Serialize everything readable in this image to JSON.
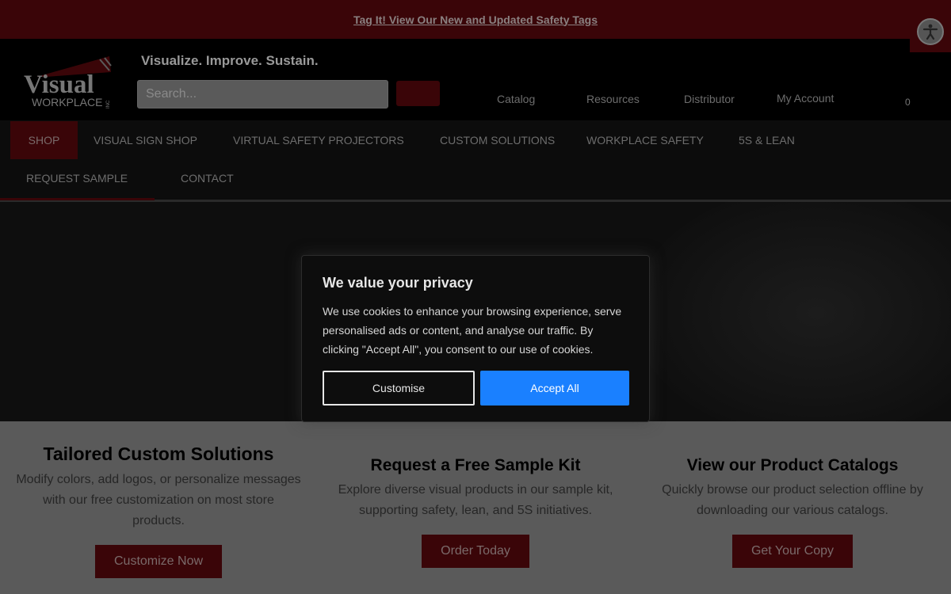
{
  "promo": {
    "link": "Tag It! View Our New and Updated Safety Tags"
  },
  "header": {
    "logo_text": "Visual",
    "logo_sub": "WORKPLACE",
    "logo_inc": "INC",
    "tagline": "Visualize. Improve. Sustain.",
    "search_placeholder": "Search...",
    "links": {
      "catalog": "Catalog",
      "resources": "Resources",
      "distributor": "Distributor",
      "account": "My Account"
    },
    "cart_count": "0"
  },
  "nav": {
    "shop": "SHOP",
    "visual_sign_shop": "VISUAL SIGN SHOP",
    "virtual_safety_projectors": "VIRTUAL SAFETY PROJECTORS",
    "custom_solutions": "CUSTOM SOLUTIONS",
    "workplace_safety": "WORKPLACE SAFETY",
    "five_s_lean": "5S & LEAN",
    "request_sample": "REQUEST SAMPLE",
    "contact": "CONTACT"
  },
  "features": [
    {
      "title": "Tailored Custom Solutions",
      "text": "Modify colors, add logos, or personalize messages with our free customization on most store products.",
      "button": "Customize Now"
    },
    {
      "title": "Request a Free Sample Kit",
      "text": "Explore diverse visual products in our sample kit, supporting safety, lean, and 5S initiatives.",
      "button": "Order Today"
    },
    {
      "title": "View our Product Catalogs",
      "text": "Quickly browse our product selection offline by downloading our various catalogs.",
      "button": "Get Your Copy"
    }
  ],
  "cookie": {
    "title": "We value your privacy",
    "body": "We use cookies to enhance your browsing experience, serve personalised ads or content, and analyse our traffic. By clicking \"Accept All\", you consent to our use of cookies.",
    "customise": "Customise",
    "accept": "Accept All"
  },
  "colors": {
    "brand_red": "#3a0508",
    "accept_blue": "#1a80ff"
  },
  "icons": {
    "accessibility": "accessibility-icon",
    "search": "search-icon",
    "cart": "cart-icon"
  }
}
